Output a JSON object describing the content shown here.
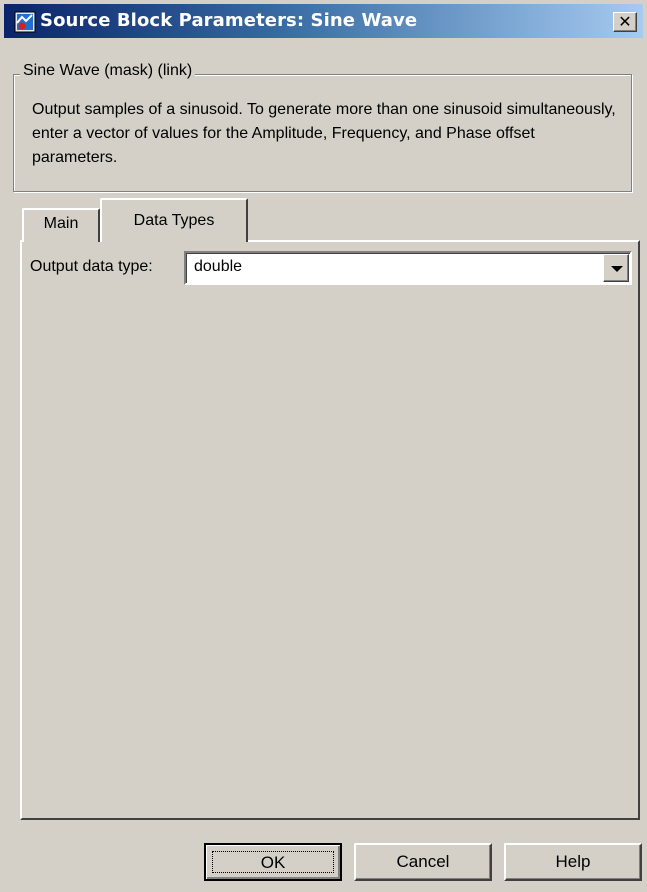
{
  "window": {
    "title": "Source Block Parameters: Sine Wave",
    "close_label": "✕"
  },
  "group": {
    "legend": "Sine Wave (mask) (link)",
    "description": "Output samples of a sinusoid.  To generate more than one sinusoid simultaneously, enter a vector of values for the Amplitude, Frequency, and Phase offset parameters."
  },
  "tabs": [
    {
      "label": "Main",
      "active": false
    },
    {
      "label": "Data Types",
      "active": true
    }
  ],
  "fields": {
    "output_data_type": {
      "label": "Output data type:",
      "value": "double"
    }
  },
  "buttons": {
    "ok": "OK",
    "cancel": "Cancel",
    "help": "Help"
  },
  "colors": {
    "dialog_bg": "#d4d0c8",
    "titlebar_start": "#0a246a",
    "titlebar_end": "#a6caf0"
  },
  "icons": {
    "window_icon": "simulink-block-icon",
    "dropdown_icon": "chevron-down-icon"
  }
}
